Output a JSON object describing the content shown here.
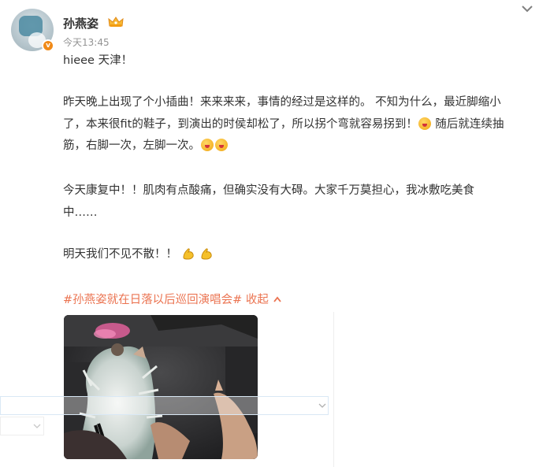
{
  "post": {
    "author": "孙燕姿",
    "verified_icon": "v",
    "timestamp": "今天13:45",
    "lines": {
      "greeting": "hieee 天津！",
      "p1_l1": "昨天晚上出现了个小插曲！来来来来，事情的经过是这样的。 不知为什么，最近脚缩小",
      "p1_l2": "了，本来很fit的鞋子，到演出的时侯却松了，所以拐个弯就容易拐到！",
      "p1_l2_after": " 随后就连续抽",
      "p1_l3": "筋，右脚一次，左脚一次。",
      "p2_l1": "今天康复中！！肌肉有点酸痛，但确实没有大碍。大家千万莫担心，我冰敷吃美食",
      "p2_l2": "中……",
      "p3_l1": "明天我们不见不散！！"
    },
    "topic": "#孙燕姿就在日落以后巡回演唱会#",
    "collapse_label": "收起",
    "colors": {
      "accent": "#eb7350",
      "text": "#333333",
      "meta": "#939393"
    },
    "icons": [
      "chevron-down-icon",
      "crown-badge-icon",
      "dizzy-face-emoji",
      "flexed-biceps-emoji",
      "chevron-up-icon"
    ]
  }
}
